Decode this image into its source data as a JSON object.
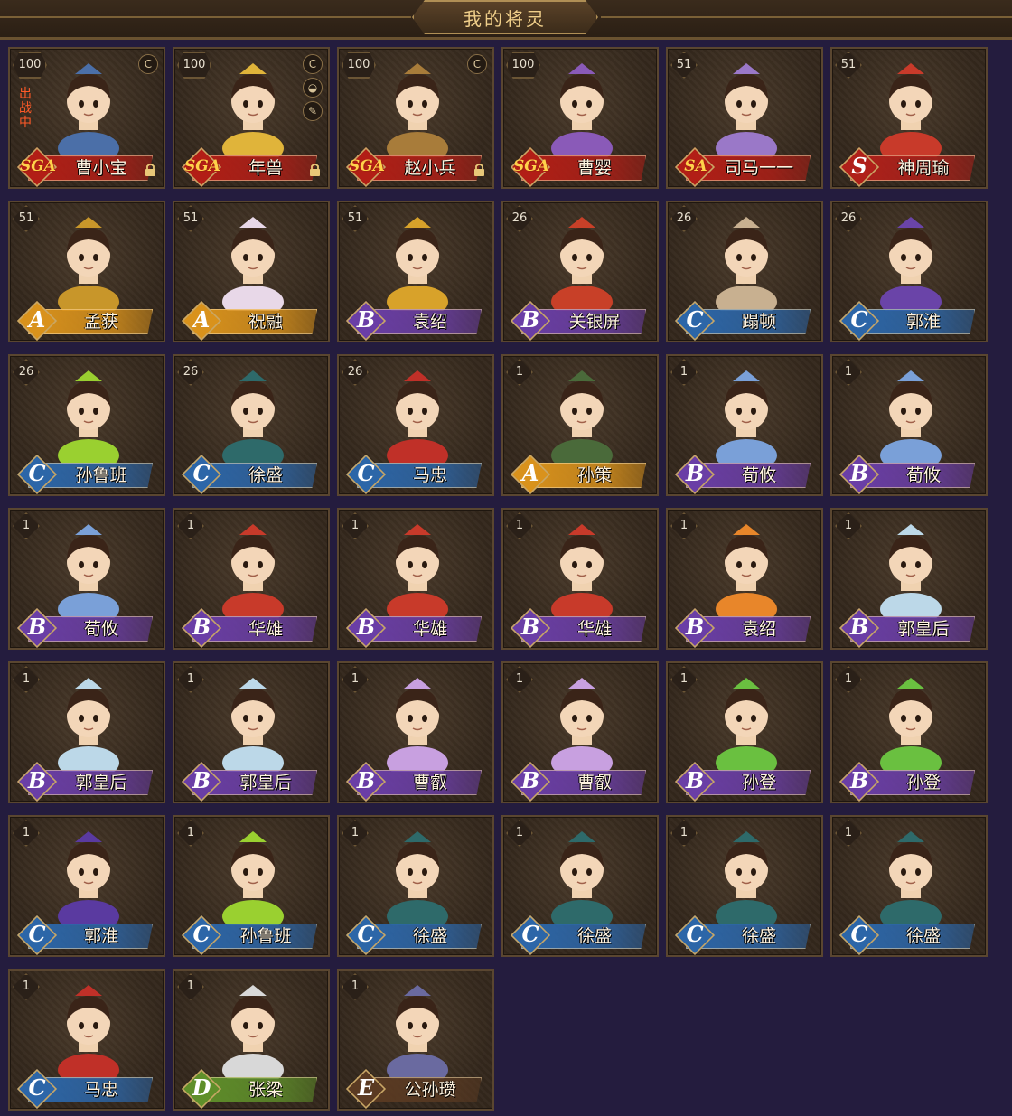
{
  "header": {
    "title": "我的将灵"
  },
  "colors": {
    "SGA": "#b21e16",
    "SA": "#b21e16",
    "S": "#b0201a",
    "A": "#d9921c",
    "B": "#6a3ea6",
    "C": "#2c66a8",
    "D": "#5f8f2a",
    "E": "#5a3a22"
  },
  "cards": [
    {
      "level": "100",
      "grade": "SGA",
      "name": "曹小宝",
      "locked": true,
      "deploy": "出战中",
      "icons": [
        "C"
      ],
      "hue": "#4b6fa8"
    },
    {
      "level": "100",
      "grade": "SGA",
      "name": "年兽",
      "locked": true,
      "icons": [
        "C",
        "◒",
        "✎"
      ],
      "hue": "#e0b43a"
    },
    {
      "level": "100",
      "grade": "SGA",
      "name": "赵小兵",
      "locked": true,
      "icons": [
        "C"
      ],
      "hue": "#a87c3a"
    },
    {
      "level": "100",
      "grade": "SGA",
      "name": "曹婴",
      "icons": [],
      "hue": "#8a5ab8"
    },
    {
      "level": "51",
      "grade": "SA",
      "name": "司马一一",
      "icons": [],
      "hue": "#9a78c8"
    },
    {
      "level": "51",
      "grade": "S",
      "name": "神周瑜",
      "icons": [],
      "hue": "#c83a2a"
    },
    {
      "level": "51",
      "grade": "A",
      "name": "孟获",
      "icons": [],
      "hue": "#c8962a"
    },
    {
      "level": "51",
      "grade": "A",
      "name": "祝融",
      "icons": [],
      "hue": "#e8d8e8"
    },
    {
      "level": "51",
      "grade": "B",
      "name": "袁绍",
      "icons": [],
      "hue": "#d8a22a"
    },
    {
      "level": "26",
      "grade": "B",
      "name": "关银屏",
      "icons": [],
      "hue": "#c84028"
    },
    {
      "level": "26",
      "grade": "C",
      "name": "蹋顿",
      "icons": [],
      "hue": "#c8b090"
    },
    {
      "level": "26",
      "grade": "C",
      "name": "郭淮",
      "icons": [],
      "hue": "#6a44a8"
    },
    {
      "level": "26",
      "grade": "C",
      "name": "孙鲁班",
      "icons": [],
      "hue": "#9ad030"
    },
    {
      "level": "26",
      "grade": "C",
      "name": "徐盛",
      "icons": [],
      "hue": "#2e6a6a"
    },
    {
      "level": "26",
      "grade": "C",
      "name": "马忠",
      "icons": [],
      "hue": "#c03028"
    },
    {
      "level": "1",
      "grade": "A",
      "name": "孙策",
      "icons": [],
      "hue": "#4a6a3a"
    },
    {
      "level": "1",
      "grade": "B",
      "name": "荀攸",
      "icons": [],
      "hue": "#7aa0d8"
    },
    {
      "level": "1",
      "grade": "B",
      "name": "荀攸",
      "icons": [],
      "hue": "#7aa0d8"
    },
    {
      "level": "1",
      "grade": "B",
      "name": "荀攸",
      "icons": [],
      "hue": "#7aa0d8"
    },
    {
      "level": "1",
      "grade": "B",
      "name": "华雄",
      "icons": [],
      "hue": "#c83a2a"
    },
    {
      "level": "1",
      "grade": "B",
      "name": "华雄",
      "icons": [],
      "hue": "#c83a2a"
    },
    {
      "level": "1",
      "grade": "B",
      "name": "华雄",
      "icons": [],
      "hue": "#c83a2a"
    },
    {
      "level": "1",
      "grade": "B",
      "name": "袁绍",
      "icons": [],
      "hue": "#e8862a"
    },
    {
      "level": "1",
      "grade": "B",
      "name": "郭皇后",
      "icons": [],
      "hue": "#bcd8e8"
    },
    {
      "level": "1",
      "grade": "B",
      "name": "郭皇后",
      "icons": [],
      "hue": "#bcd8e8"
    },
    {
      "level": "1",
      "grade": "B",
      "name": "郭皇后",
      "icons": [],
      "hue": "#bcd8e8"
    },
    {
      "level": "1",
      "grade": "B",
      "name": "曹叡",
      "icons": [],
      "hue": "#c8a0e0"
    },
    {
      "level": "1",
      "grade": "B",
      "name": "曹叡",
      "icons": [],
      "hue": "#c8a0e0"
    },
    {
      "level": "1",
      "grade": "B",
      "name": "孙登",
      "icons": [],
      "hue": "#6ac040"
    },
    {
      "level": "1",
      "grade": "B",
      "name": "孙登",
      "icons": [],
      "hue": "#6ac040"
    },
    {
      "level": "1",
      "grade": "C",
      "name": "郭淮",
      "icons": [],
      "hue": "#5a3aa0"
    },
    {
      "level": "1",
      "grade": "C",
      "name": "孙鲁班",
      "icons": [],
      "hue": "#9ad030"
    },
    {
      "level": "1",
      "grade": "C",
      "name": "徐盛",
      "icons": [],
      "hue": "#2e6a6a"
    },
    {
      "level": "1",
      "grade": "C",
      "name": "徐盛",
      "icons": [],
      "hue": "#2e6a6a"
    },
    {
      "level": "1",
      "grade": "C",
      "name": "徐盛",
      "icons": [],
      "hue": "#2e6a6a"
    },
    {
      "level": "1",
      "grade": "C",
      "name": "徐盛",
      "icons": [],
      "hue": "#2e6a6a"
    },
    {
      "level": "1",
      "grade": "C",
      "name": "马忠",
      "icons": [],
      "hue": "#c03028"
    },
    {
      "level": "1",
      "grade": "D",
      "name": "张梁",
      "icons": [],
      "hue": "#d8d8d8"
    },
    {
      "level": "1",
      "grade": "E",
      "name": "公孙瓒",
      "icons": [],
      "hue": "#6a6aa0"
    }
  ]
}
